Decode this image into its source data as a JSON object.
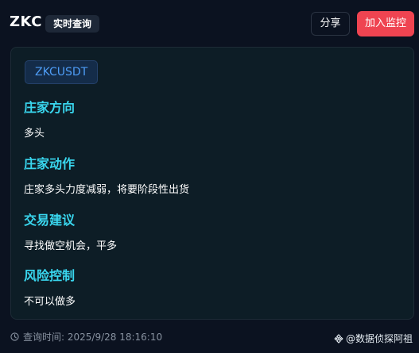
{
  "header": {
    "title": "ZKC",
    "badge": "实时查询",
    "share_label": "分享",
    "monitor_label": "加入监控"
  },
  "card": {
    "symbol": "ZKCUSDT",
    "sections": [
      {
        "title": "庄家方向",
        "text": "多头"
      },
      {
        "title": "庄家动作",
        "text": "庄家多头力度减弱，将要阶段性出货"
      },
      {
        "title": "交易建议",
        "text": "寻找做空机会，平多"
      },
      {
        "title": "风险控制",
        "text": "不可以做多"
      }
    ]
  },
  "footer": {
    "query_time": "查询时间: 2025/9/28 18:16:10",
    "brand": "@数据侦探阿祖"
  },
  "icons": {
    "clock": "clock-icon",
    "brand": "binance-diamond-icon"
  },
  "colors": {
    "background": "#0b1220",
    "card": "#0d1d26",
    "accent_cyan": "#39d6ee",
    "chip_blue": "#4e9cf5",
    "monitor_red": "#ef4451"
  }
}
